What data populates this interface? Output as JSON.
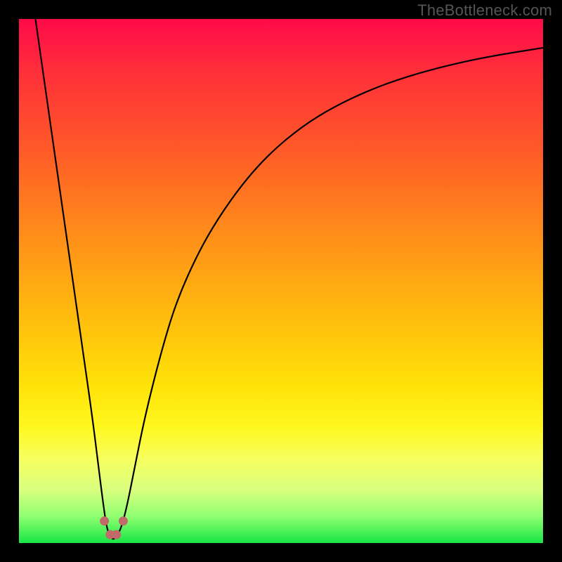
{
  "watermark": "TheBottleneck.com",
  "chart_data": {
    "type": "line",
    "title": "",
    "xlabel": "",
    "ylabel": "",
    "xlim": [
      0,
      100
    ],
    "ylim": [
      0,
      100
    ],
    "grid": false,
    "legend": false,
    "background": {
      "type": "vertical-gradient",
      "description": "Vertical gradient mapping bottleneck severity: green (low) at bottom through yellow/orange to red (high) at top.",
      "stops": [
        {
          "offset": 0.0,
          "color": "#ff0a4a"
        },
        {
          "offset": 0.1,
          "color": "#ff2f3a"
        },
        {
          "offset": 0.25,
          "color": "#ff5a28"
        },
        {
          "offset": 0.4,
          "color": "#ff8a1a"
        },
        {
          "offset": 0.55,
          "color": "#ffb70f"
        },
        {
          "offset": 0.7,
          "color": "#ffe208"
        },
        {
          "offset": 0.78,
          "color": "#fff820"
        },
        {
          "offset": 0.84,
          "color": "#f6ff60"
        },
        {
          "offset": 0.9,
          "color": "#d8ff80"
        },
        {
          "offset": 0.95,
          "color": "#8dff70"
        },
        {
          "offset": 1.0,
          "color": "#17e546"
        }
      ]
    },
    "series": [
      {
        "name": "bottleneck-curve",
        "color": "#000000",
        "x": [
          0,
          2,
          4,
          6,
          8,
          10,
          12,
          14,
          15,
          16,
          16.8,
          17.6,
          18,
          18.5,
          19.5,
          20.6,
          22,
          24,
          27,
          30,
          34,
          38,
          43,
          48,
          54,
          60,
          67,
          74,
          82,
          90,
          100
        ],
        "y": [
          122,
          108,
          94,
          80,
          66,
          52,
          38,
          24,
          16,
          8,
          2.5,
          1.0,
          0.7,
          1.1,
          2.8,
          7,
          14,
          24,
          36,
          46,
          55,
          62,
          69,
          74.5,
          79.5,
          83.2,
          86.5,
          89,
          91.2,
          92.9,
          94.5
        ]
      }
    ],
    "markers": [
      {
        "name": "dot-left-outer",
        "x": 16.3,
        "y": 4.2,
        "r": 6.5,
        "color": "#c26a6a"
      },
      {
        "name": "dot-left-inner",
        "x": 17.4,
        "y": 1.6,
        "r": 6.5,
        "color": "#c26a6a"
      },
      {
        "name": "dot-right-inner",
        "x": 18.6,
        "y": 1.6,
        "r": 6.5,
        "color": "#c26a6a"
      },
      {
        "name": "dot-right-outer",
        "x": 19.9,
        "y": 4.2,
        "r": 6.5,
        "color": "#c26a6a"
      }
    ]
  }
}
